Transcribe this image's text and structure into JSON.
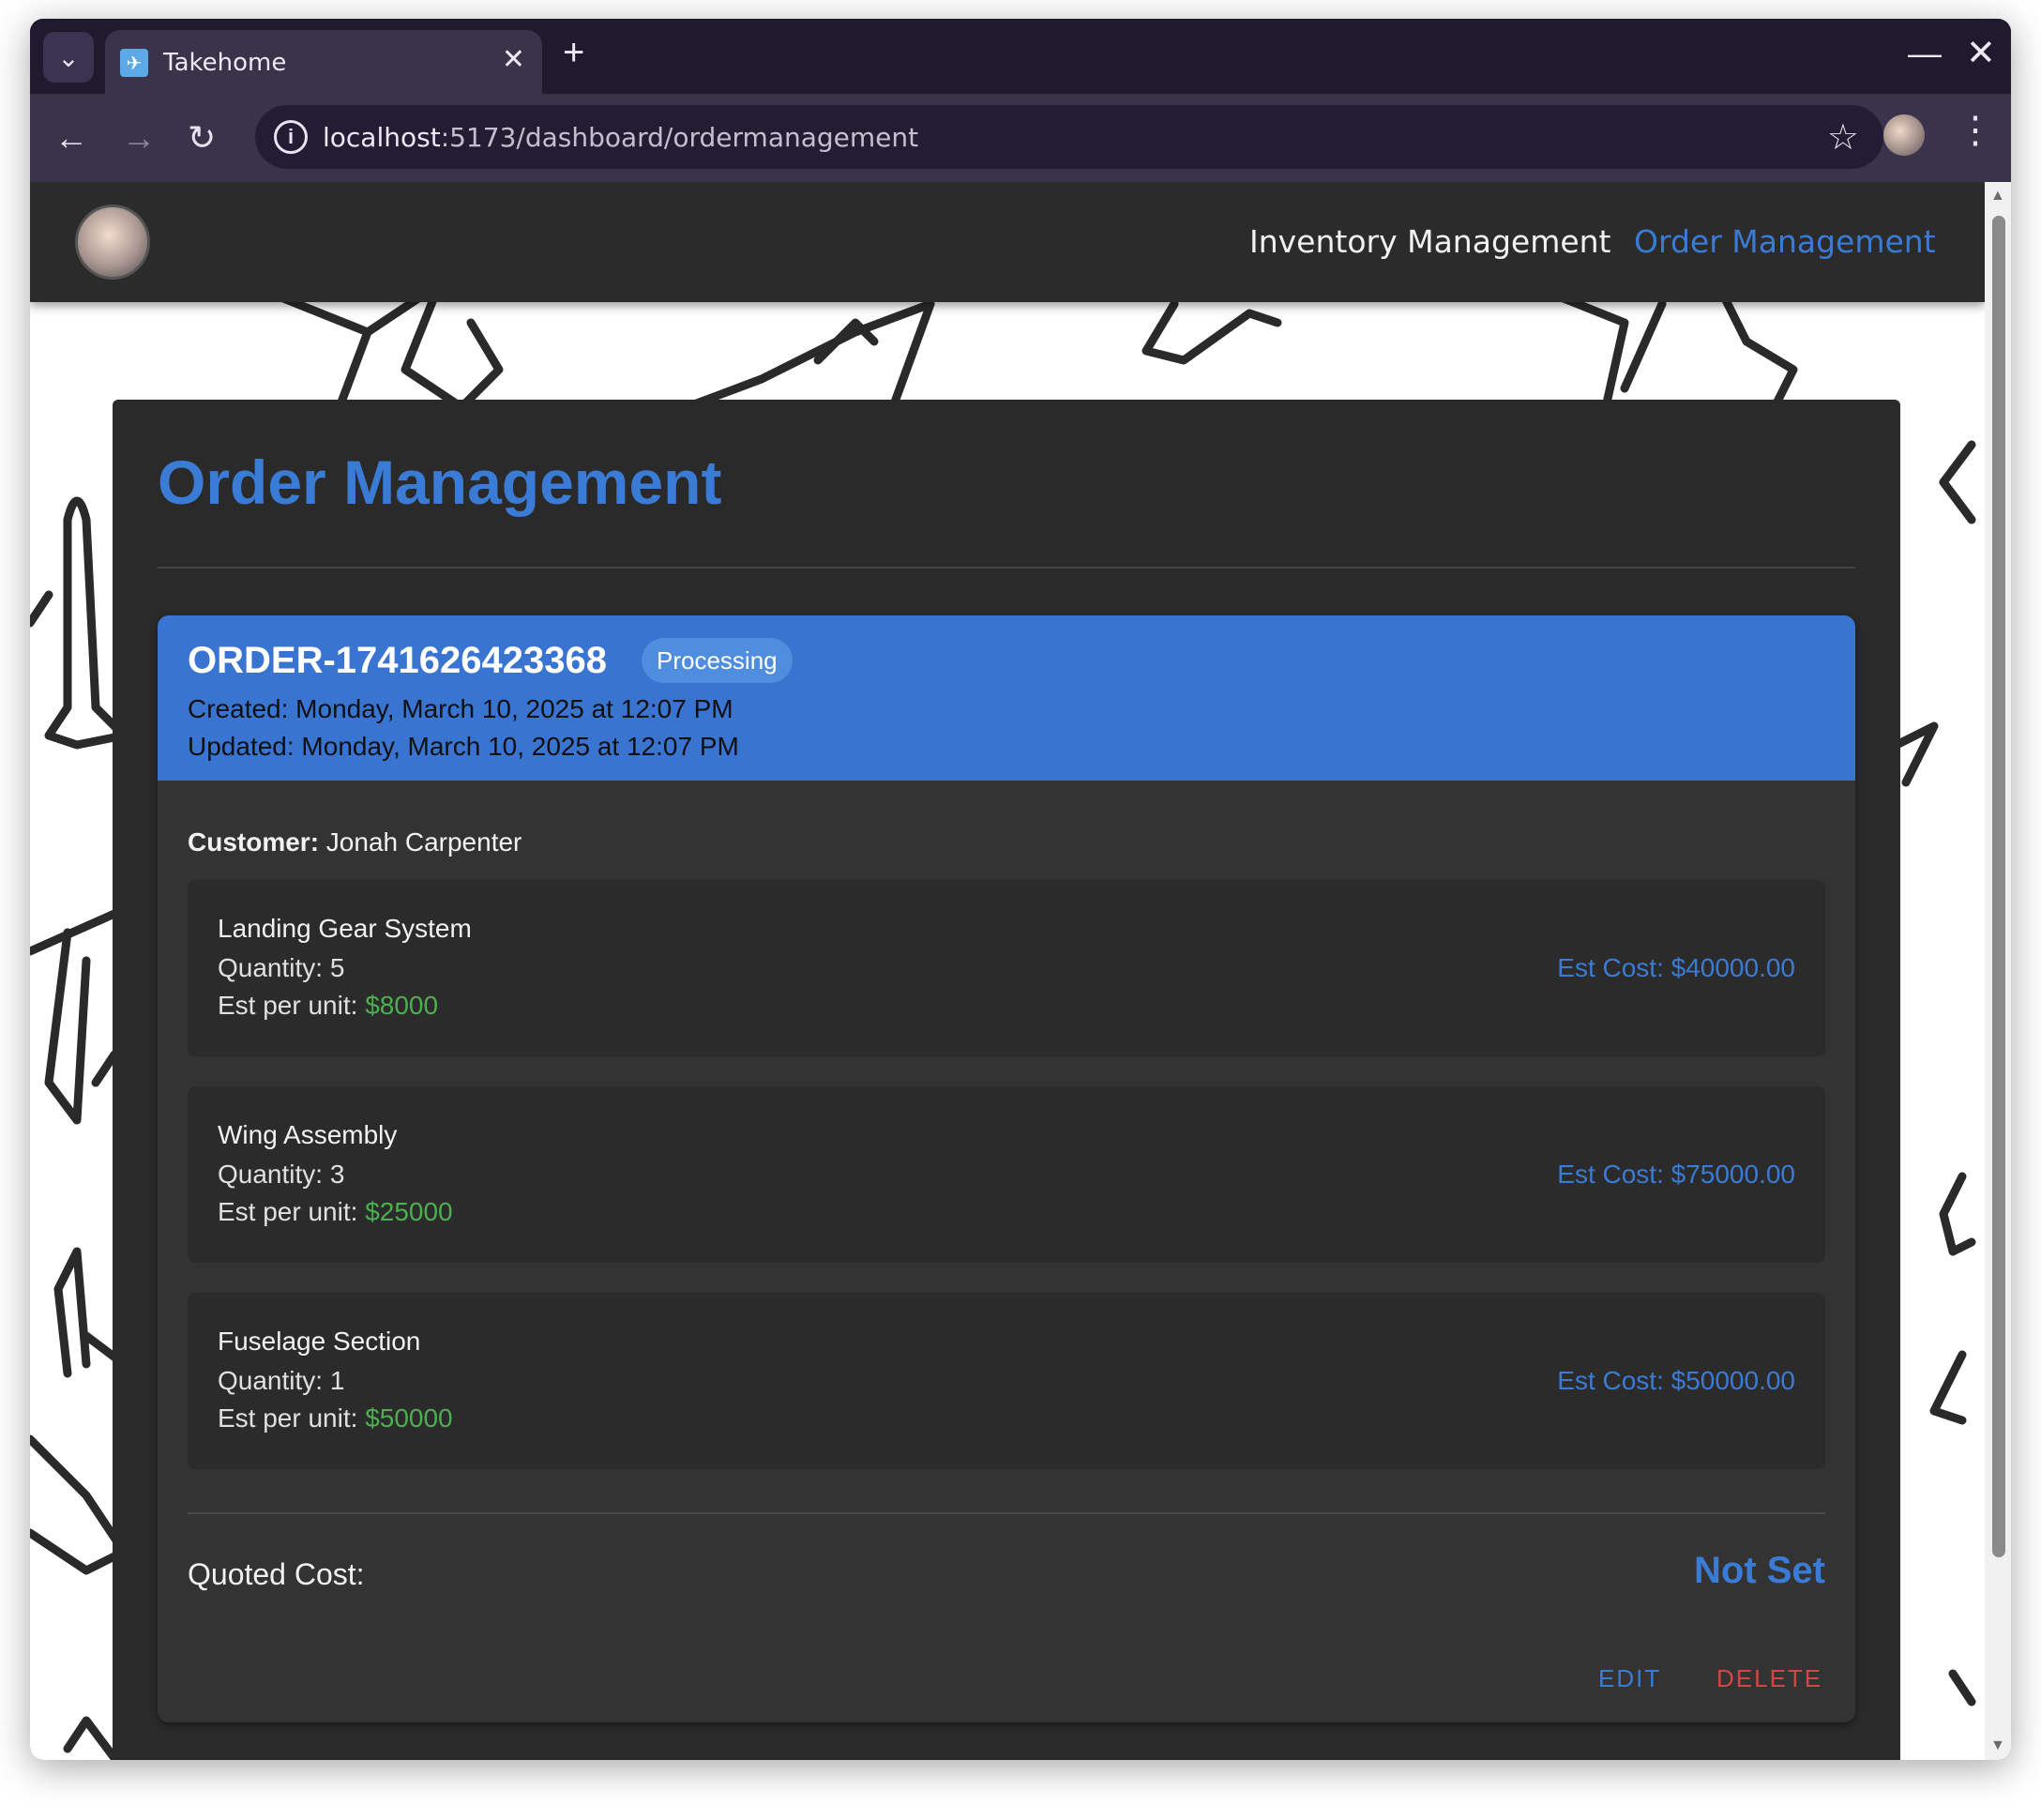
{
  "browser": {
    "tab_title": "Takehome",
    "url_host": "localhost",
    "url_rest": ":5173/dashboard/ordermanagement"
  },
  "app": {
    "nav": {
      "inventory": "Inventory Management",
      "orders": "Order Management"
    },
    "page_title": "Order Management"
  },
  "order": {
    "id": "ORDER-1741626423368",
    "status": "Processing",
    "created": "Created: Monday, March 10, 2025 at 12:07 PM",
    "updated": "Updated: Monday, March 10, 2025 at 12:07 PM",
    "customer_label": "Customer:",
    "customer_name": "Jonah Carpenter",
    "items": [
      {
        "name": "Landing Gear System",
        "quantity": "Quantity: 5",
        "unit_label": "Est per unit: ",
        "unit_price": "$8000",
        "cost": "Est Cost: $40000.00"
      },
      {
        "name": "Wing Assembly",
        "quantity": "Quantity: 3",
        "unit_label": "Est per unit: ",
        "unit_price": "$25000",
        "cost": "Est Cost: $75000.00"
      },
      {
        "name": "Fuselage Section",
        "quantity": "Quantity: 1",
        "unit_label": "Est per unit: ",
        "unit_price": "$50000",
        "cost": "Est Cost: $50000.00"
      }
    ],
    "quoted_label": "Quoted Cost:",
    "quoted_value": "Not Set",
    "edit_label": "EDIT",
    "delete_label": "DELETE"
  },
  "colors": {
    "accent": "#3a7bd5",
    "header_bg": "#3874d0",
    "price_green": "#4caf50",
    "delete_red": "#d64545"
  }
}
